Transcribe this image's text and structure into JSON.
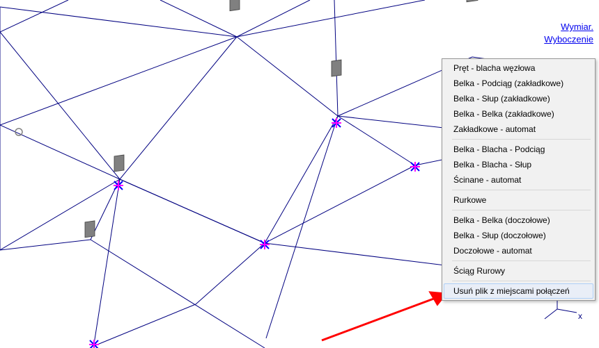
{
  "top_links": {
    "link1": "Wymiar.",
    "link2": "Wyboczenie"
  },
  "menu": {
    "group1": [
      "Pręt - blacha węzłowa",
      "Belka - Podciąg (zakładkowe)",
      "Belka - Słup (zakładkowe)",
      "Belka - Belka (zakładkowe)",
      "Zakładkowe - automat"
    ],
    "group2": [
      "Belka - Blacha - Podciąg",
      "Belka - Blacha - Słup",
      "Ścinane - automat"
    ],
    "group3": [
      "Rurkowe"
    ],
    "group4": [
      "Belka - Belka (doczołowe)",
      "Belka - Słup (doczołowe)",
      "Doczołowe - automat"
    ],
    "group5": [
      "Ściąg Rurowy"
    ],
    "group6": [
      "Usuń plik z miejscami połączeń"
    ]
  },
  "axis": {
    "x": "x"
  },
  "colors": {
    "wire": "#000080",
    "node_marker": "#ff00ff",
    "cross_marker": "#0000ff",
    "plate_fill": "#808080",
    "arrow": "#ff0000"
  }
}
